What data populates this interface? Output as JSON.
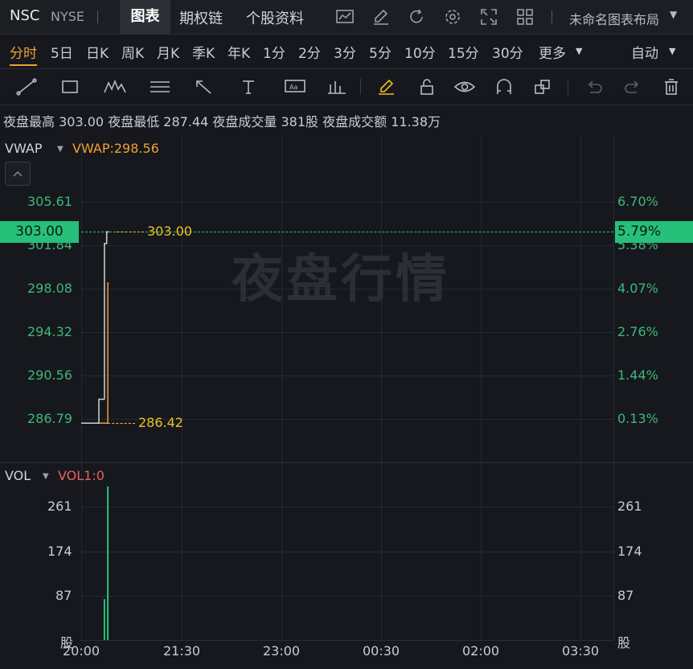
{
  "top": {
    "ticker": "NSC",
    "exchange": "NYSE",
    "tabs": [
      "图表",
      "期权链",
      "个股资料"
    ],
    "layout_label": "未命名图表布局",
    "icons": [
      "line-chart-icon",
      "edit-icon",
      "refresh-icon",
      "settings-icon",
      "fullscreen-icon",
      "grid-layout-icon"
    ]
  },
  "periods": [
    "分时",
    "5日",
    "日K",
    "周K",
    "月K",
    "季K",
    "年K",
    "1分",
    "2分",
    "3分",
    "5分",
    "10分",
    "15分",
    "30分",
    "更多"
  ],
  "auto_label": "自动",
  "info": {
    "high_label": "夜盘最高",
    "high": "303.00",
    "low_label": "夜盘最低",
    "low": "287.44",
    "vol_label": "夜盘成交量",
    "vol": "381股",
    "amt_label": "夜盘成交额",
    "amt": "11.38万"
  },
  "main_panel": {
    "indicator": "VWAP",
    "indicator_value": "VWAP:298.56",
    "watermark": "夜盘行情",
    "current_price": "303.00",
    "current_pct": "5.79%",
    "price_ticks": [
      "305.61",
      "301.84",
      "298.08",
      "294.32",
      "290.56",
      "286.79"
    ],
    "pct_ticks": [
      "6.70%",
      "5.38%",
      "4.07%",
      "2.76%",
      "1.44%",
      "0.13%"
    ],
    "high_marker": "303.00",
    "low_marker": "286.42"
  },
  "volume_panel": {
    "indicator": "VOL",
    "indicator_value": "VOL1:0",
    "ticks": [
      "261",
      "174",
      "87",
      "股"
    ]
  },
  "chart_data": {
    "type": "line",
    "x_ticks": [
      "20:00",
      "21:30",
      "23:00",
      "00:30",
      "02:00",
      "03:30"
    ],
    "price_series": {
      "x": [
        "20:00",
        "20:16",
        "20:16",
        "20:21",
        "20:21",
        "20:23",
        "20:23",
        "20:25"
      ],
      "y": [
        286.42,
        286.42,
        288.5,
        288.5,
        302.0,
        302.0,
        303.0,
        303.0
      ]
    },
    "vwap_series": {
      "x": [
        "20:00",
        "20:24",
        "20:24",
        "20:25"
      ],
      "y": [
        286.42,
        286.42,
        298.56,
        298.56
      ]
    },
    "volume_bars": [
      {
        "x": "20:21",
        "value": 80
      },
      {
        "x": "20:24",
        "value": 300
      }
    ],
    "ylim": [
      285.0,
      307.0
    ],
    "vol_ylim": [
      0,
      300
    ],
    "colors": {
      "price": "#d0d2d6",
      "vwap": "#f0a030",
      "volume": "#27c07a",
      "up": "#3fb77a"
    }
  }
}
